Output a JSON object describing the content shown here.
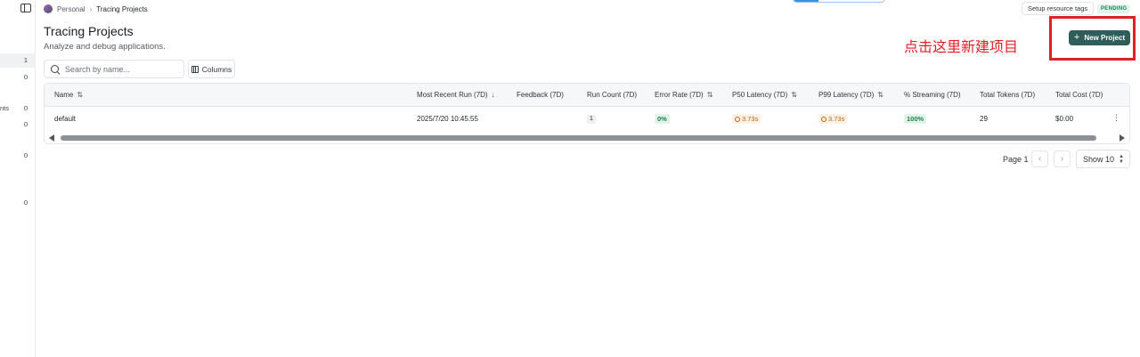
{
  "breadcrumb": {
    "workspace": "Personal",
    "current": "Tracing Projects"
  },
  "header": {
    "setup_label": "Setup resource tags",
    "status": "PENDING"
  },
  "page": {
    "title": "Tracing Projects",
    "subtitle": "Analyze and debug applications.",
    "new_project_label": "New Project"
  },
  "annotation": {
    "text": "点击这里新建项目",
    "color": "#e21f26"
  },
  "sidebar": {
    "items": [
      {
        "label": "",
        "count": "1",
        "active": true
      },
      {
        "label": "",
        "count": "0"
      },
      {
        "label": "nts",
        "count": "0"
      },
      {
        "label": "",
        "count": "0"
      },
      {
        "label": "",
        "count": "0"
      },
      {
        "label": "",
        "count": "0"
      }
    ]
  },
  "toolbar": {
    "search_placeholder": "Search by name...",
    "columns_label": "Columns"
  },
  "table": {
    "columns": [
      "Name",
      "Most Recent Run (7D)",
      "Feedback (7D)",
      "Run Count (7D)",
      "Error Rate (7D)",
      "P50 Latency (7D)",
      "P99 Latency (7D)",
      "% Streaming (7D)",
      "Total Tokens (7D)",
      "Total Cost (7D)"
    ],
    "rows": [
      {
        "name": "default",
        "recent": "2025/7/20 10:45:55",
        "feedback": "",
        "run_count": "1",
        "error_rate": "0%",
        "p50": "3.73s",
        "p99": "3.73s",
        "streaming": "100%",
        "tokens": "29",
        "cost": "$0.00"
      }
    ]
  },
  "pagination": {
    "page_label": "Page 1",
    "show_label": "Show 10"
  },
  "colors": {
    "brand_button": "#2f5e5a",
    "success": "#1d7f4e",
    "warning": "#c0661a",
    "pending_bg": "#e3f4ec"
  }
}
